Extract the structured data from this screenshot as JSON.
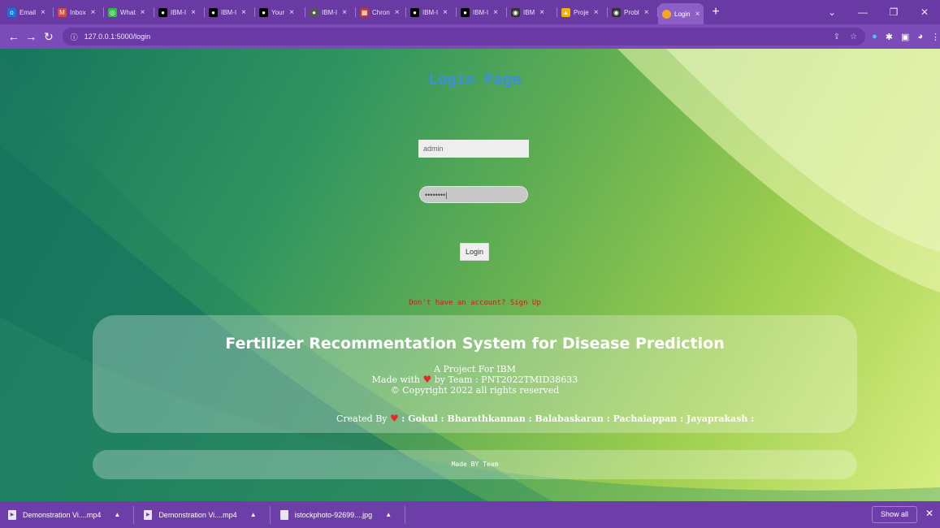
{
  "browser": {
    "tabs": [
      {
        "label": "Email",
        "icon": "outlook-icon",
        "color": "#1d74d4",
        "glyph": "o"
      },
      {
        "label": "Inbox",
        "icon": "gmail-icon",
        "color": "#d9473c",
        "glyph": "M"
      },
      {
        "label": "What",
        "icon": "whatsapp-icon",
        "color": "#2fbd4a",
        "glyph": "◎"
      },
      {
        "label": "IBM-I",
        "icon": "github-icon",
        "color": "#000000",
        "glyph": "●"
      },
      {
        "label": "IBM-I",
        "icon": "github-icon",
        "color": "#000000",
        "glyph": "●"
      },
      {
        "label": "Your",
        "icon": "github-icon",
        "color": "#000000",
        "glyph": "●"
      },
      {
        "label": "IBM-I",
        "icon": "github-icon",
        "color": "#555555",
        "glyph": "●"
      },
      {
        "label": "Chron",
        "icon": "calendar-icon",
        "color": "#c0392b",
        "glyph": "▦"
      },
      {
        "label": "IBM-I",
        "icon": "github-icon",
        "color": "#000000",
        "glyph": "●"
      },
      {
        "label": "IBM-I",
        "icon": "github-icon",
        "color": "#000000",
        "glyph": "●"
      },
      {
        "label": "IBM",
        "icon": "globe-icon",
        "color": "#333333",
        "glyph": "◉"
      },
      {
        "label": "Proje",
        "icon": "drive-icon",
        "color": "#f4b400",
        "glyph": "▲"
      },
      {
        "label": "Probl",
        "icon": "globe-icon",
        "color": "#333333",
        "glyph": "◉"
      }
    ],
    "active_tab": {
      "label": "Login",
      "icon": "favicon-icon",
      "color": "#f5a623"
    },
    "new_tab": "+",
    "url": "127.0.0.1:5000/login"
  },
  "page": {
    "title": "Login Page",
    "username_value": "admin",
    "password_value": "••••••••|",
    "login_label": "Login",
    "signup_text": "Don't have an account? Sign Up"
  },
  "footer": {
    "title": "Fertilizer Recommentation System for Disease Prediction",
    "line1": "A Project For IBM",
    "line2_prefix": "Made with",
    "line2_suffix": "by Team : PNT2022TMID38633",
    "line3": "© Copyright 2022 all rights reserved",
    "credits_prefix": "Created By",
    "credits_names": ": Gokul : Bharathkannan : Balabaskaran : Pachaiappan : Jayaprakash :",
    "made_by": "Made BY Team"
  },
  "downloads": {
    "items": [
      {
        "name": "Demonstration Vi....mp4"
      },
      {
        "name": "Demonstration Vi....mp4"
      },
      {
        "name": "istockphoto-92699....jpg"
      }
    ],
    "show_all": "Show all"
  },
  "colors": {
    "title_blue": "#3c8fdc",
    "signup_red": "#cc1d1d",
    "chrome_purple": "#6a3aa4"
  }
}
